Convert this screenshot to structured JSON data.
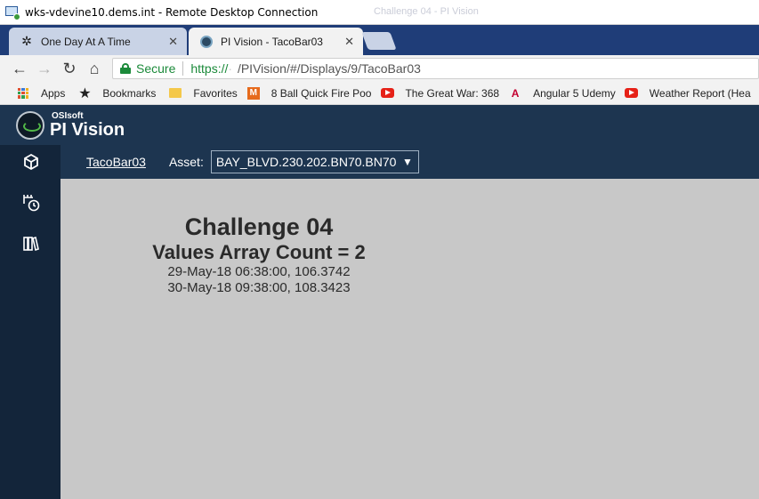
{
  "rdp": {
    "title": "wks-vdevine10.dems.int - Remote Desktop Connection",
    "ghost_text": "Challenge 04 - PI Vision"
  },
  "tabs": [
    {
      "label": "One Day At A Time",
      "icon": "gear-icon"
    },
    {
      "label": "PI Vision - TacoBar03",
      "icon": "pi-vision-favicon"
    }
  ],
  "address": {
    "secure_label": "Secure",
    "scheme": "https://",
    "host_redacted": "·           ",
    "path": "/PIVision/#/Displays/9/TacoBar03"
  },
  "bookmarks": [
    {
      "label": "Apps",
      "icon": "apps-icon"
    },
    {
      "label": "Bookmarks",
      "icon": "star-icon"
    },
    {
      "label": "Favorites",
      "icon": "folder-icon"
    },
    {
      "label": "8 Ball Quick Fire Poo",
      "icon": "m-icon"
    },
    {
      "label": "The Great War: 368",
      "icon": "youtube-icon"
    },
    {
      "label": "Angular 5 Udemy",
      "icon": "angular-icon"
    },
    {
      "label": "Weather Report (Hea",
      "icon": "youtube-icon"
    }
  ],
  "pi": {
    "vendor": "OSIsoft",
    "product": "PI Vision"
  },
  "display_bar": {
    "display_name": "TacoBar03",
    "asset_label": "Asset:",
    "asset_value": "BAY_BLVD.230.202.BN70.BN70"
  },
  "widget": {
    "title": "Challenge 04",
    "subtitle": "Values Array Count = 2",
    "values": [
      "29-May-18 06:38:00, 106.3742",
      "30-May-18 09:38:00, 108.3423"
    ]
  },
  "colors": {
    "tab_strip": "#1f3d78",
    "pi_header": "#1d3550",
    "left_nav": "#13253a",
    "canvas": "#c8c8c8",
    "secure_green": "#1b8a3a"
  }
}
